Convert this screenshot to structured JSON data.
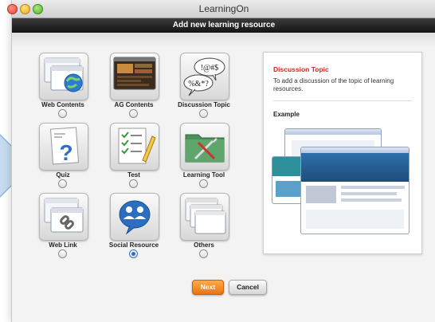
{
  "window": {
    "title": "LearningOn"
  },
  "header": {
    "title": "Add new learning resource"
  },
  "options": [
    {
      "label": "Web Contents",
      "icon": "web-contents-icon",
      "selected": false
    },
    {
      "label": "AG Contents",
      "icon": "ag-contents-icon",
      "selected": false
    },
    {
      "label": "Discussion Topic",
      "icon": "speech-bubbles-icon",
      "selected": false,
      "bubble1": "!@#$",
      "bubble2": "%&*?"
    },
    {
      "label": "Quiz",
      "icon": "quiz-icon",
      "selected": false
    },
    {
      "label": "Test",
      "icon": "test-checklist-icon",
      "selected": false
    },
    {
      "label": "Learning Tool",
      "icon": "folder-tools-icon",
      "selected": false
    },
    {
      "label": "Web Link",
      "icon": "web-link-icon",
      "selected": false
    },
    {
      "label": "Social Resource",
      "icon": "social-resource-icon",
      "selected": true
    },
    {
      "label": "Others",
      "icon": "others-windows-icon",
      "selected": false
    }
  ],
  "panel": {
    "title": "Discussion Topic",
    "description": "To add a discussion of the topic of learning resources.",
    "example_label": "Example"
  },
  "buttons": {
    "next": "Next",
    "cancel": "Cancel"
  },
  "colors": {
    "accent_red": "#d4261c",
    "next_orange": "#f08a1e",
    "selected_radio": "#2f6fc5",
    "header_dark": "#1e1e1e"
  }
}
